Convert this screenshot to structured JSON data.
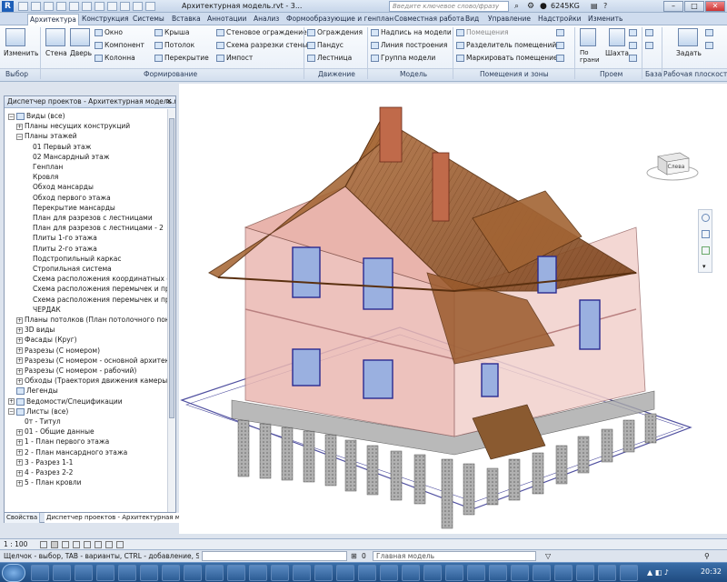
{
  "titlebar": {
    "title": "Архитектурная модель.rvt - 3...",
    "search_placeholder": "Введите ключевое слово/фразу",
    "user": "6245KG",
    "app_icon": "R"
  },
  "tabs": [
    "Архитектура",
    "Конструкция",
    "Системы",
    "Вставка",
    "Аннотации",
    "Анализ",
    "Формообразующие и генплан",
    "Совместная работа",
    "Вид",
    "Управление",
    "Надстройки",
    "Изменить"
  ],
  "ribbon": {
    "select": {
      "modify": "Изменить",
      "panel": "Выбор"
    },
    "build": {
      "wall": "Стена",
      "door": "Дверь",
      "window": "Окно",
      "component": "Компонент",
      "column": "Колонна",
      "roof": "Крыша",
      "ceiling": "Потолок",
      "floor": "Перекрытие",
      "curtain_system": "Стеновое ограждение",
      "curtain_grid": "Схема разрезки стены",
      "mullion": "Импост",
      "panel": "Формирование"
    },
    "circulation": {
      "railing": "Ограждения",
      "ramp": "Пандус",
      "stair": "Лестница",
      "panel": "Движение"
    },
    "model": {
      "model_text": "Надпись на модели",
      "model_line": "Линия  построения",
      "model_group": "Группа модели",
      "panel": "Модель"
    },
    "room": {
      "room": "Помещения",
      "room_separator": "Разделитель помещений",
      "tag_room": "Маркировать помещение",
      "panel": "Помещения и зоны"
    },
    "opening": {
      "by_face": "По грани",
      "shaft": "Шахта",
      "panel": "Проем"
    },
    "datum": {
      "panel": "База"
    },
    "work_plane": {
      "set": "Задать",
      "panel": "Рабочая плоскость"
    }
  },
  "project_browser": {
    "title": "Диспетчер проектов - Архитектурная модель.rvt",
    "close": "✕",
    "tree": [
      {
        "label": "Виды (все)",
        "level": 0,
        "exp": "−",
        "icon": "views"
      },
      {
        "label": "Планы несущих конструкций",
        "level": 1,
        "exp": "+"
      },
      {
        "label": "Планы этажей",
        "level": 1,
        "exp": "−"
      },
      {
        "label": "01 Первый этаж",
        "level": 2
      },
      {
        "label": "02 Мансардный этаж",
        "level": 2
      },
      {
        "label": "Генплан",
        "level": 2
      },
      {
        "label": "Кровля",
        "level": 2
      },
      {
        "label": "Обход мансарды",
        "level": 2
      },
      {
        "label": "Обход первого этажа",
        "level": 2
      },
      {
        "label": "Перекрытие мансарды",
        "level": 2
      },
      {
        "label": "План для разрезов с лестницами",
        "level": 2
      },
      {
        "label": "План для разрезов с лестницами - 2",
        "level": 2
      },
      {
        "label": "Плиты 1-го этажа",
        "level": 2
      },
      {
        "label": "Плиты 2-го этажа",
        "level": 2
      },
      {
        "label": "Подстропильный каркас",
        "level": 2
      },
      {
        "label": "Стропильная система",
        "level": 2
      },
      {
        "label": "Схема расположения координатных с",
        "level": 2
      },
      {
        "label": "Схема расположения перемычек и пр",
        "level": 2
      },
      {
        "label": "Схема расположения перемычек и пр",
        "level": 2
      },
      {
        "label": "ЧЕРДАК",
        "level": 2
      },
      {
        "label": "Планы потолков (План потолочного покр",
        "level": 1,
        "exp": "+"
      },
      {
        "label": "3D виды",
        "level": 1,
        "exp": "+"
      },
      {
        "label": "Фасады (Круг)",
        "level": 1,
        "exp": "+"
      },
      {
        "label": "Разрезы (С номером)",
        "level": 1,
        "exp": "+"
      },
      {
        "label": "Разрезы (С номером - основной архитект",
        "level": 1,
        "exp": "+"
      },
      {
        "label": "Разрезы (С номером - рабочий)",
        "level": 1,
        "exp": "+"
      },
      {
        "label": "Обходы (Траектория движения камеры)",
        "level": 1,
        "exp": "+"
      },
      {
        "label": "Легенды",
        "level": 0,
        "icon": "legend"
      },
      {
        "label": "Ведомости/Спецификации",
        "level": 0,
        "exp": "+",
        "icon": "schedule"
      },
      {
        "label": "Листы (все)",
        "level": 0,
        "exp": "−",
        "icon": "sheets"
      },
      {
        "label": "0т - Титул",
        "level": 1
      },
      {
        "label": "01 - Общие данные",
        "level": 1,
        "exp": "+"
      },
      {
        "label": "1 - План первого этажа",
        "level": 1,
        "exp": "+"
      },
      {
        "label": "2 - План мансардного этажа",
        "level": 1,
        "exp": "+"
      },
      {
        "label": "3 - Разрез 1-1",
        "level": 1,
        "exp": "+"
      },
      {
        "label": "4 - Разрез 2-2",
        "level": 1,
        "exp": "+"
      },
      {
        "label": "5 - План кровли",
        "level": 1,
        "exp": "+"
      }
    ],
    "tabs": [
      "Свойства",
      "Диспетчер проектов - Архитектурная м..."
    ]
  },
  "viewcube": {
    "label": "Слева"
  },
  "status": {
    "scale": "1 : 100",
    "hint": "Щелчок - выбор, TAB - варианты, CTRL - добавление, SHIF",
    "model_label": "Главная модель",
    "zoom": "0"
  },
  "taskbar": {
    "clock": "20:32"
  },
  "colors": {
    "roof": "#9a5a2c",
    "wall": "#e9b7b0",
    "piles": "#8a8a8a",
    "window": "#4040a8"
  }
}
